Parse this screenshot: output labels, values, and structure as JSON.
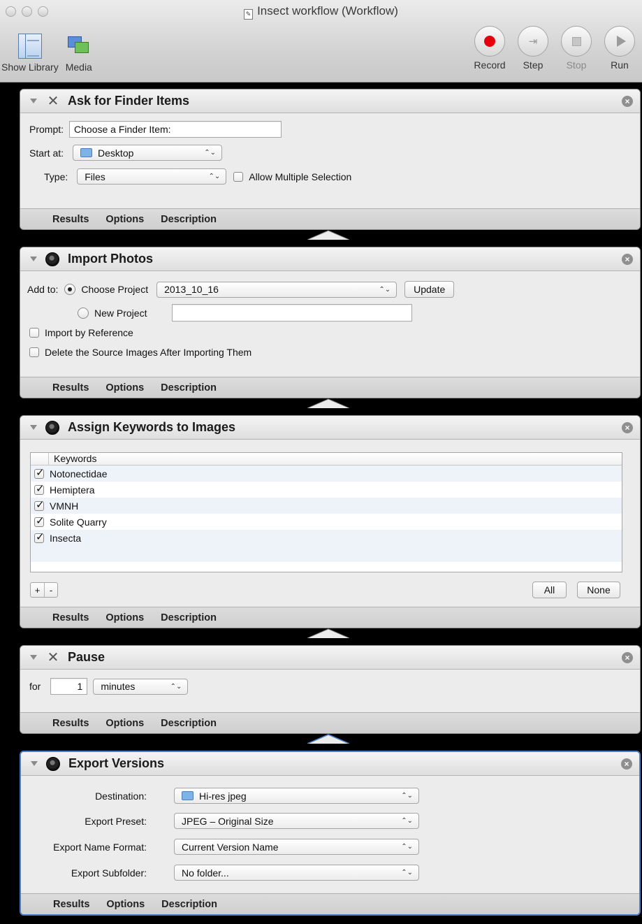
{
  "window": {
    "title": "Insect workflow (Workflow)"
  },
  "toolbar": {
    "show_library": "Show Library",
    "media": "Media",
    "record": "Record",
    "step": "Step",
    "stop": "Stop",
    "run": "Run"
  },
  "footer_tabs": {
    "results": "Results",
    "options": "Options",
    "description": "Description"
  },
  "actions": {
    "ask_finder": {
      "title": "Ask for Finder Items",
      "prompt_label": "Prompt:",
      "prompt_value": "Choose a Finder Item:",
      "start_label": "Start at:",
      "start_value": "Desktop",
      "type_label": "Type:",
      "type_value": "Files",
      "allow_multiple": "Allow Multiple Selection"
    },
    "import_photos": {
      "title": "Import Photos",
      "add_to_label": "Add to:",
      "choose_project": "Choose Project",
      "project_value": "2013_10_16",
      "update_button": "Update",
      "new_project": "New Project",
      "import_by_reference": "Import by Reference",
      "delete_source": "Delete the Source Images After Importing Them"
    },
    "assign_keywords": {
      "title": "Assign Keywords to Images",
      "column_header": "Keywords",
      "keywords": [
        {
          "label": "Notonectidae",
          "checked": true
        },
        {
          "label": "Hemiptera",
          "checked": true
        },
        {
          "label": "VMNH",
          "checked": true
        },
        {
          "label": "Solite Quarry",
          "checked": true
        },
        {
          "label": "Insecta",
          "checked": true
        }
      ],
      "add_symbol": "+",
      "remove_symbol": "-",
      "all_button": "All",
      "none_button": "None"
    },
    "pause": {
      "title": "Pause",
      "for_label": "for",
      "amount": "1",
      "unit": "minutes"
    },
    "export_versions": {
      "title": "Export Versions",
      "destination_label": "Destination:",
      "destination_value": "Hi-res jpeg",
      "preset_label": "Export Preset:",
      "preset_value": "JPEG – Original Size",
      "name_format_label": "Export Name Format:",
      "name_format_value": "Current Version Name",
      "subfolder_label": "Export Subfolder:",
      "subfolder_value": "No folder..."
    }
  },
  "colors": {
    "record_red": "#e6000e",
    "selection_blue": "#4a7ec9",
    "close_gray": "#8f8f8f"
  }
}
